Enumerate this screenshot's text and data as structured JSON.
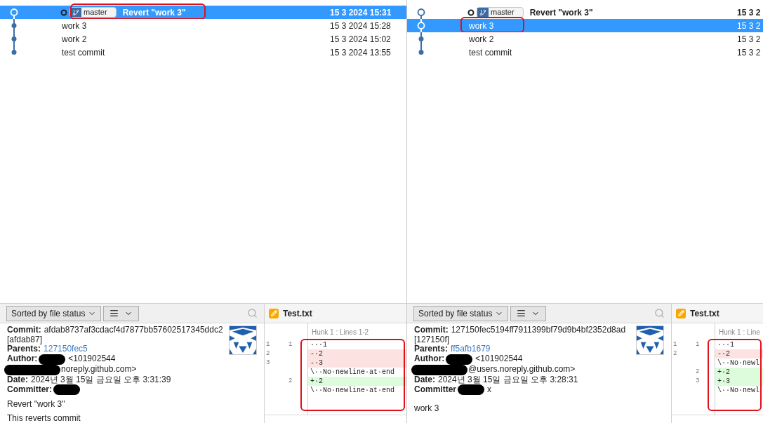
{
  "panes": [
    {
      "commits": [
        {
          "message": "Revert \"work 3\"",
          "date": "15 3 2024 15:31",
          "head": true,
          "branch": "master",
          "selected": true,
          "hollow": true,
          "annotated": true
        },
        {
          "message": "work 3",
          "date": "15 3 2024 15:28",
          "head": false,
          "selected": false,
          "hollow": false,
          "annotated": false
        },
        {
          "message": "work 2",
          "date": "15 3 2024 15:02",
          "head": false,
          "selected": false,
          "hollow": false,
          "annotated": false
        },
        {
          "message": "test commit",
          "date": "15 3 2024 13:55",
          "head": false,
          "selected": false,
          "hollow": false,
          "annotated": false
        }
      ],
      "sort": "Sorted by file status",
      "details": [
        {
          "kind": "field",
          "label": "Commit:",
          "value": "afdab8737af3cdacf4d7877bb57602517345ddc2"
        },
        {
          "kind": "text",
          "value": "[afdab87]"
        },
        {
          "kind": "link",
          "label": "Parents:",
          "value": "127150fec5"
        },
        {
          "kind": "field",
          "label": "Author:",
          "redacted": true,
          "value": "<101902544"
        },
        {
          "kind": "text",
          "redacted": true,
          "value": "noreply.github.com>"
        },
        {
          "kind": "field",
          "label": "Date:",
          "value": "2024년 3월 15일 금요일 오후 3:31:39"
        },
        {
          "kind": "field",
          "label": "Committer:",
          "redacted": true
        },
        {
          "kind": "blank"
        },
        {
          "kind": "text",
          "value": "Revert \"work 3\""
        },
        {
          "kind": "blank"
        },
        {
          "kind": "text",
          "value": "This reverts commit"
        }
      ],
      "diff": {
        "file": "Test.txt",
        "hunk": "Hunk 1 : Lines 1-2",
        "annotated": true,
        "lines": [
          {
            "kind": "context",
            "old": "1",
            "new": "1",
            "text": "···1"
          },
          {
            "kind": "removed",
            "old": "2",
            "text": "-·2"
          },
          {
            "kind": "removed",
            "old": "3",
            "text": "-·3"
          },
          {
            "kind": "context",
            "text": "\\··No·newline·at·end"
          },
          {
            "kind": "added",
            "new": "2",
            "text": "+·2"
          },
          {
            "kind": "context",
            "text": "\\··No·newline·at·end"
          }
        ]
      }
    },
    {
      "commits": [
        {
          "message": "Revert \"work 3\"",
          "date": "15 3 2",
          "head": true,
          "branch": "master",
          "selected": false,
          "hollow": true,
          "annotated": false
        },
        {
          "message": "work 3",
          "date": "15 3 2",
          "head": false,
          "selected": true,
          "hollow": true,
          "annotated": true
        },
        {
          "message": "work 2",
          "date": "15 3 2",
          "head": false,
          "selected": false,
          "hollow": false,
          "annotated": false
        },
        {
          "message": "test commit",
          "date": "15 3 2",
          "head": false,
          "selected": false,
          "hollow": false,
          "annotated": false
        }
      ],
      "sort": "Sorted by file status",
      "details": [
        {
          "kind": "field",
          "label": "Commit:",
          "value": "127150fec5194ff7911399bf79d9b4bf2352d8ad"
        },
        {
          "kind": "text",
          "value": "[127150f]"
        },
        {
          "kind": "link",
          "label": "Parents:",
          "value": "ff5afb1679"
        },
        {
          "kind": "field",
          "label": "Author:",
          "redacted": true,
          "value": "<101902544"
        },
        {
          "kind": "text",
          "redacted": true,
          "value": "@users.noreply.github.com>"
        },
        {
          "kind": "field",
          "label": "Date:",
          "value": "2024년 3월 15일 금요일 오후 3:28:31"
        },
        {
          "kind": "field",
          "label": "Committer",
          "redacted": true,
          "value": "x"
        },
        {
          "kind": "blank"
        },
        {
          "kind": "text",
          "value": "work 3"
        }
      ],
      "diff": {
        "file": "Test.txt",
        "hunk": "Hunk 1 : Line",
        "annotated": true,
        "lines": [
          {
            "kind": "context",
            "old": "1",
            "new": "1",
            "text": "···1"
          },
          {
            "kind": "removed",
            "old": "2",
            "text": "-·2"
          },
          {
            "kind": "context",
            "text": "\\··No·newl"
          },
          {
            "kind": "added",
            "new": "2",
            "text": "+·2"
          },
          {
            "kind": "added",
            "new": "3",
            "text": "+·3"
          },
          {
            "kind": "context",
            "text": "\\··No·newl"
          }
        ]
      }
    }
  ]
}
